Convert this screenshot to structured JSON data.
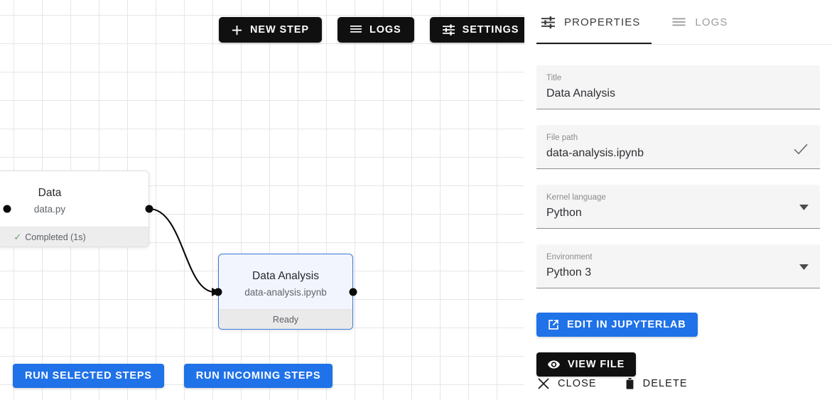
{
  "toolbar": {
    "buttons": [
      {
        "label": "NEW STEP",
        "icon": "plus-icon"
      },
      {
        "label": "LOGS",
        "icon": "list-icon"
      },
      {
        "label": "SETTINGS",
        "icon": "tune-icon"
      }
    ]
  },
  "canvas": {
    "run_buttons": [
      {
        "label": "RUN SELECTED STEPS"
      },
      {
        "label": "RUN INCOMING STEPS"
      }
    ],
    "nodes": [
      {
        "title": "Data",
        "file": "data.py",
        "status": "Completed (1s)",
        "status_check": "✓",
        "selected": false
      },
      {
        "title": "Data Analysis",
        "file": "data-analysis.ipynb",
        "status": "Ready",
        "selected": true
      }
    ]
  },
  "panel": {
    "tabs": [
      {
        "label": "PROPERTIES",
        "icon": "tune-icon",
        "active": true
      },
      {
        "label": "LOGS",
        "icon": "list-icon",
        "active": false
      }
    ],
    "fields": [
      {
        "label": "Title",
        "value": "Data Analysis",
        "trailing": "check-icon"
      },
      {
        "label": "File path",
        "value": "data-analysis.ipynb",
        "trailing": "check-icon"
      },
      {
        "label": "Kernel language",
        "value": "Python",
        "trailing": "chevron-down-icon"
      },
      {
        "label": "Environment",
        "value": "Python 3",
        "trailing": "chevron-down-icon"
      }
    ],
    "actions": [
      {
        "label": "EDIT IN JUPYTERLAB",
        "icon": "external-link-icon",
        "style": "blue"
      },
      {
        "label": "VIEW FILE",
        "icon": "eye-icon",
        "style": "dark"
      }
    ],
    "footer_actions": [
      {
        "label": "CLOSE",
        "icon": "close-icon"
      },
      {
        "label": "DELETE",
        "icon": "trash-icon"
      }
    ]
  },
  "colors": {
    "accent_blue": "#1f72e8",
    "dark": "#101010",
    "selected_node_border": "#3b7dd8",
    "success_green": "#5fa463"
  }
}
